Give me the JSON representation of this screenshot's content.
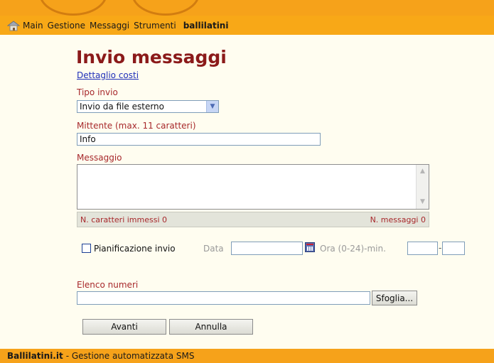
{
  "menu": {
    "items": [
      "Main",
      "Gestione",
      "Messaggi",
      "Strumenti"
    ],
    "user": "ballilatini"
  },
  "page": {
    "title": "Invio messaggi",
    "cost_link": "Dettaglio costi"
  },
  "form": {
    "tipo_invio_label": "Tipo invio",
    "tipo_invio_value": "Invio da file esterno",
    "mittente_label": "Mittente (max. 11 caratteri)",
    "mittente_value": "Info",
    "messaggio_label": "Messaggio",
    "messaggio_value": "",
    "chars_label": "N. caratteri immessi 0",
    "messages_label": "N. messaggi 0",
    "scheduling_label": "Pianificazione invio",
    "scheduling_checked": false,
    "data_label": "Data",
    "ora_label": "Ora (0-24)-min.",
    "separator": "-",
    "elenco_label": "Elenco numeri",
    "browse_label": "Sfoglia...",
    "avanti_label": "Avanti",
    "annulla_label": "Annulla"
  },
  "footer": {
    "brand": "Ballilatini.it",
    "text": "- Gestione automatizzata SMS"
  },
  "colors": {
    "bar": "#F8A817",
    "title": "#8B1A1A",
    "label": "#A7282B",
    "link": "#1f2fb8",
    "background": "#FFFDF0"
  },
  "icons": {
    "home": "home-icon",
    "calendar": "calendar-icon",
    "dropdown": "chevron-down-icon"
  }
}
